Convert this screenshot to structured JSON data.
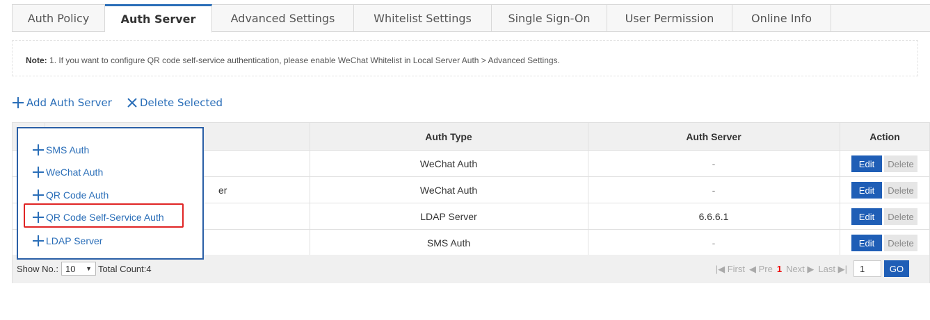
{
  "tabs": [
    {
      "label": "Auth Policy"
    },
    {
      "label": "Auth Server"
    },
    {
      "label": "Advanced Settings"
    },
    {
      "label": "Whitelist Settings"
    },
    {
      "label": "Single Sign-On"
    },
    {
      "label": "User Permission"
    },
    {
      "label": "Online Info"
    }
  ],
  "note": {
    "label": "Note:",
    "text": "1. If you want to configure QR code self-service authentication, please enable WeChat Whitelist in Local Server Auth > Advanced Settings."
  },
  "toolbar": {
    "add_label": "Add Auth Server",
    "delete_label": "Delete Selected"
  },
  "table": {
    "headers": {
      "auth_type": "Auth Type",
      "auth_server": "Auth Server",
      "action": "Action"
    },
    "rows": [
      {
        "name_partial": "",
        "auth_type": "WeChat Auth",
        "auth_server": "-"
      },
      {
        "name_partial": "er",
        "auth_type": "WeChat Auth",
        "auth_server": "-"
      },
      {
        "name_partial": "",
        "auth_type": "LDAP Server",
        "auth_server": "6.6.6.1"
      },
      {
        "name_partial": "",
        "auth_type": "SMS Auth",
        "auth_server": "-"
      }
    ],
    "edit_label": "Edit",
    "delete_label": "Delete"
  },
  "footer": {
    "show_no_label": "Show No.:",
    "show_no_value": "10",
    "total_label": "Total Count:4",
    "first": "First",
    "pre": "Pre",
    "current_page": "1",
    "next": "Next",
    "last": "Last",
    "page_input": "1",
    "go_label": "GO"
  },
  "dropdown": {
    "items": [
      {
        "label": "SMS Auth"
      },
      {
        "label": "WeChat Auth"
      },
      {
        "label": "QR Code Auth"
      },
      {
        "label": "QR Code Self-Service Auth"
      },
      {
        "label": "LDAP Server"
      }
    ],
    "highlighted_index": 3
  },
  "colors": {
    "accent": "#2a6eb8",
    "button_blue": "#1f5eb6",
    "highlight_red": "#e02424",
    "current_page_red": "#e00000"
  }
}
